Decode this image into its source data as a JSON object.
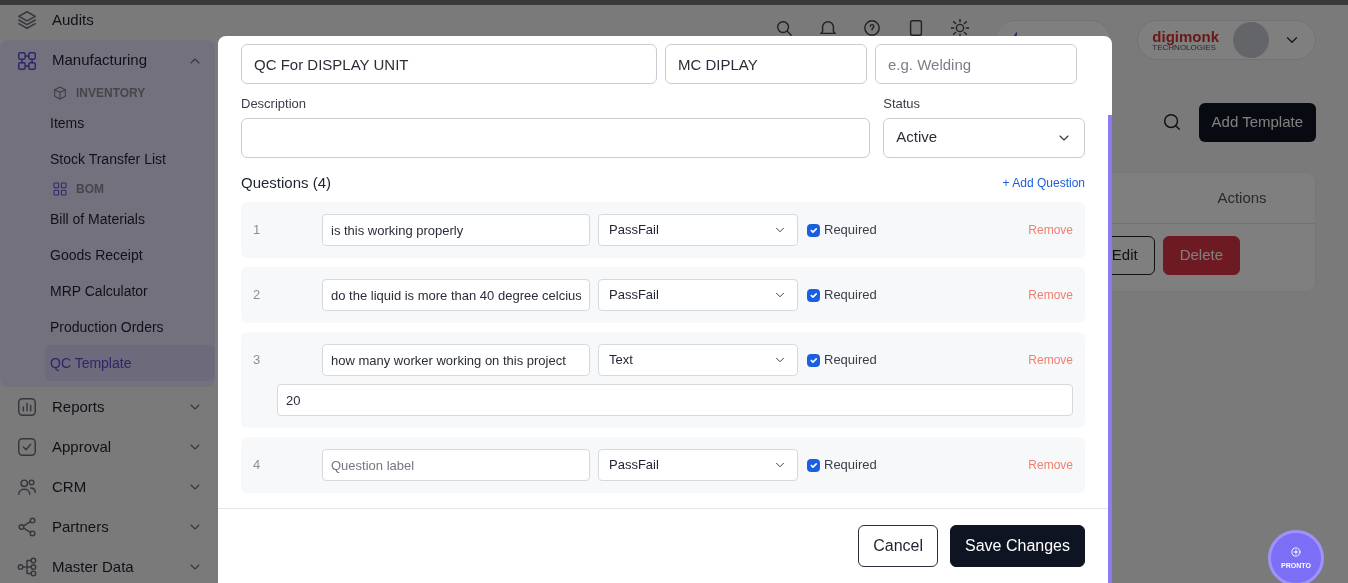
{
  "top_bar": {
    "logo_text": "digimonk",
    "logo_tagline": "TECHNOLOGIES"
  },
  "sidebar": {
    "items": [
      {
        "kind": "link",
        "label": "Audits",
        "selected": false
      },
      {
        "kind": "group",
        "label": "Manufacturing",
        "selected": true,
        "expanded": true,
        "children": [
          {
            "kind": "heading",
            "label": "INVENTORY"
          },
          {
            "kind": "link",
            "label": "Items",
            "selected": false
          },
          {
            "kind": "link",
            "label": "Stock Transfer List",
            "selected": false
          },
          {
            "kind": "heading",
            "label": "BOM"
          },
          {
            "kind": "link",
            "label": "Bill of Materials",
            "selected": false
          },
          {
            "kind": "link",
            "label": "Goods Receipt",
            "selected": false
          },
          {
            "kind": "link",
            "label": "MRP Calculator",
            "selected": false
          },
          {
            "kind": "link",
            "label": "Production Orders",
            "selected": false
          },
          {
            "kind": "link",
            "label": "QC Template",
            "selected": true
          }
        ]
      },
      {
        "kind": "group",
        "label": "Reports",
        "selected": false,
        "expanded": false
      },
      {
        "kind": "group",
        "label": "Approval",
        "selected": false,
        "expanded": false
      },
      {
        "kind": "group",
        "label": "CRM",
        "selected": false,
        "expanded": false
      },
      {
        "kind": "group",
        "label": "Partners",
        "selected": false,
        "expanded": false
      },
      {
        "kind": "group",
        "label": "Master Data",
        "selected": false,
        "expanded": false
      }
    ]
  },
  "page": {
    "add_button": "Add Template",
    "table": {
      "columns": [
        "Actions"
      ],
      "rows": [
        {
          "actions": [
            "Edit",
            "Delete"
          ]
        }
      ]
    }
  },
  "modal": {
    "fields": [
      {
        "value": "QC For DISPLAY UNIT"
      },
      {
        "value": "MC DIPLAY"
      },
      {
        "placeholder": "e.g. Welding"
      }
    ],
    "description": {
      "label": "Description"
    },
    "status": {
      "label": "Status",
      "value": "Active"
    },
    "questions_title": "Questions (4)",
    "add_question": "+ Add Question",
    "questions": [
      {
        "number": "1",
        "value": "is this working properly",
        "type": "PassFail",
        "required": true,
        "required_label": "Required",
        "remove": "Remove"
      },
      {
        "number": "2",
        "value": "do the liquid is more than 40 degree celcius",
        "type": "PassFail",
        "required": true,
        "required_label": "Required",
        "remove": "Remove"
      },
      {
        "number": "3",
        "value": "how many worker working on this project",
        "type": "Text",
        "required": true,
        "required_label": "Required",
        "remove": "Remove",
        "answer": "20"
      },
      {
        "number": "4",
        "placeholder": "Question label",
        "type": "PassFail",
        "required": true,
        "required_label": "Required",
        "remove": "Remove"
      }
    ],
    "buttons": [
      {
        "kind": "secondary",
        "label": "Cancel"
      },
      {
        "kind": "primary",
        "label": "Save Changes"
      }
    ]
  },
  "assistant": {
    "label": "PRONTO"
  }
}
